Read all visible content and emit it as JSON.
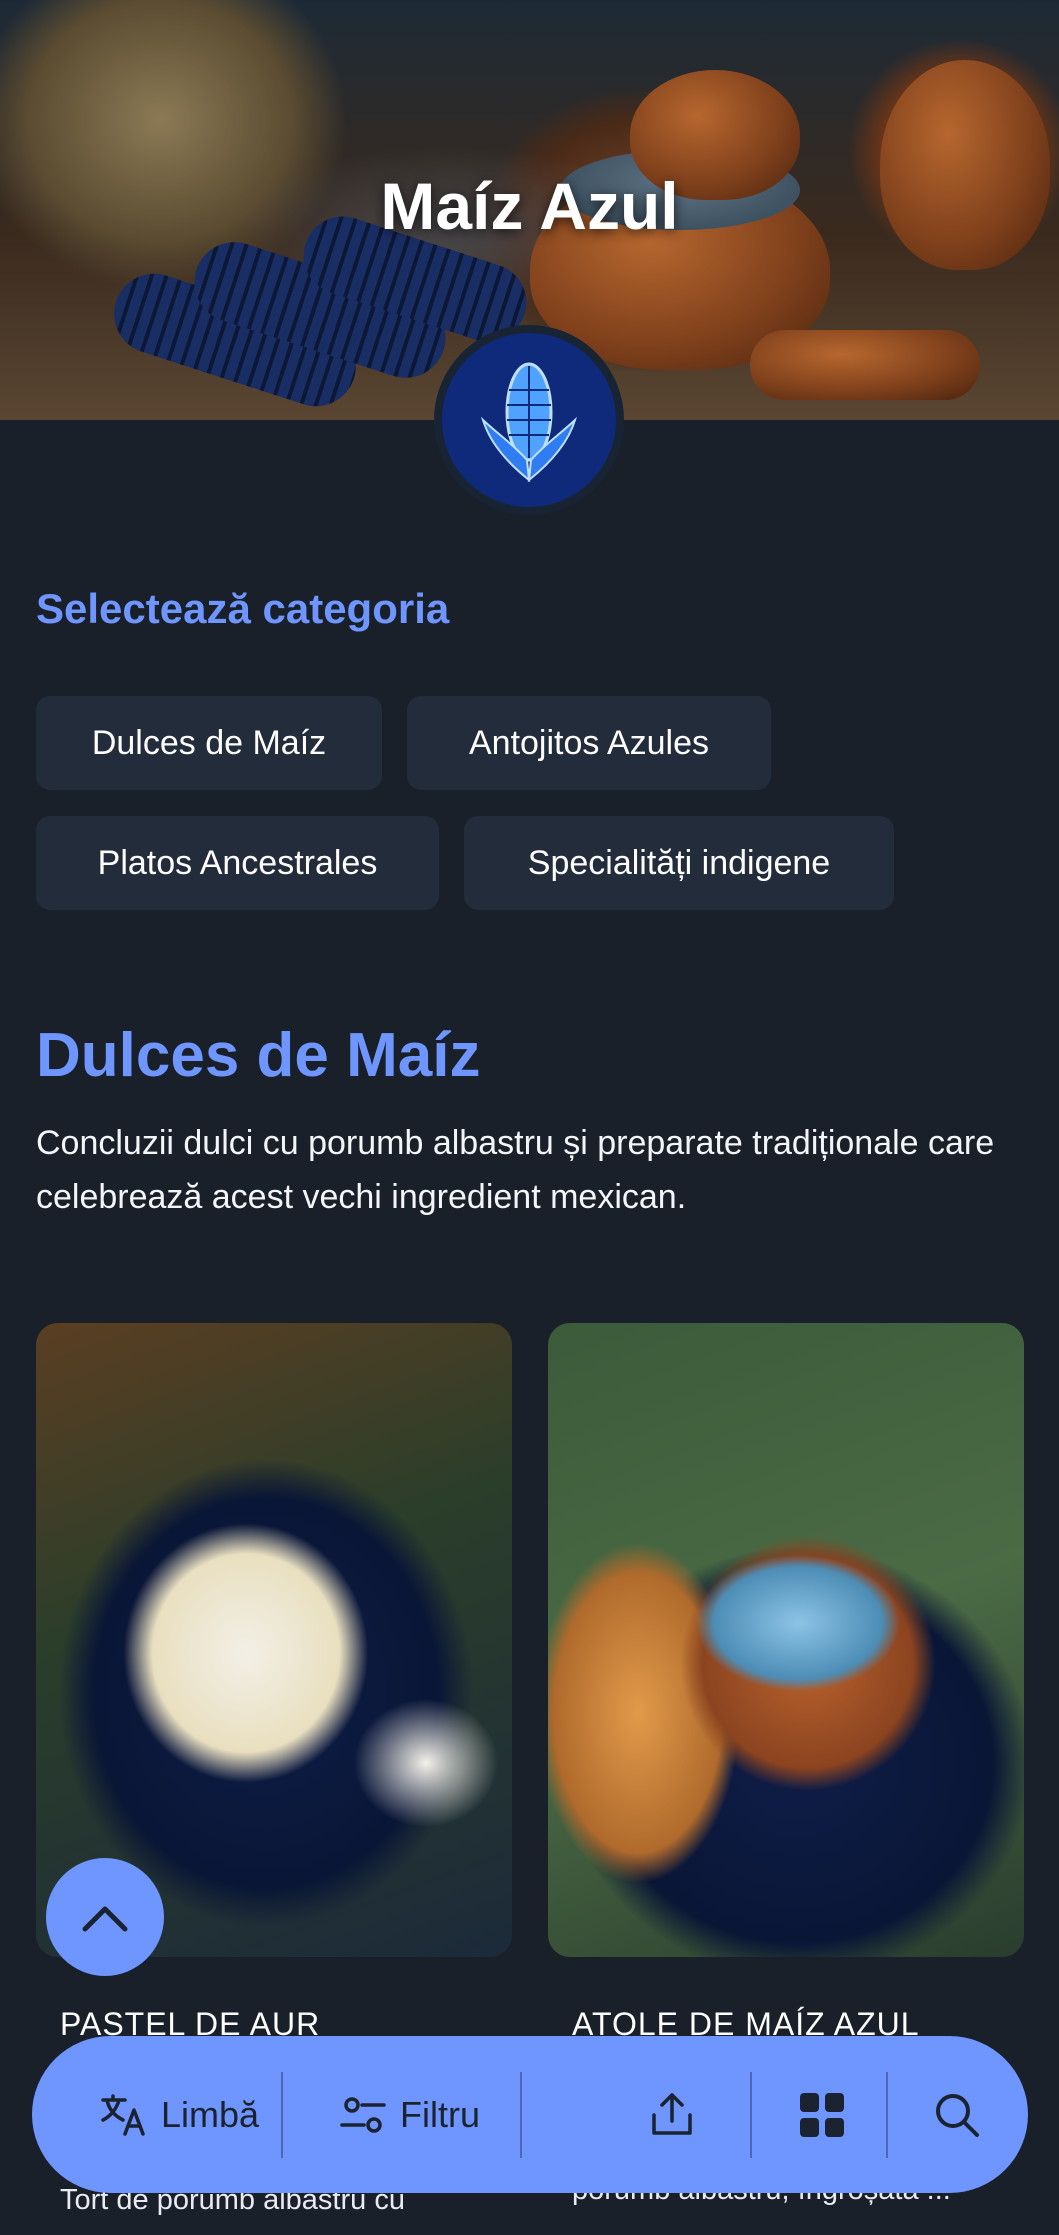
{
  "hero": {
    "title": "Maíz Azul"
  },
  "categories": {
    "heading": "Selectează categoria",
    "chips": [
      "Dulces de Maíz",
      "Antojitos Azules",
      "Platos Ancestrales",
      "Specialități indigene"
    ]
  },
  "section": {
    "title": "Dulces de Maíz",
    "description": "Concluzii dulci cu porumb albastru și preparate tradiționale care celebrează acest vechi ingredient mexican."
  },
  "cards": [
    {
      "title": "PASTEL DE AUR",
      "text": "Tort de porumb albastru cu"
    },
    {
      "title": "ATOLE DE MAÍZ AZUL",
      "text": "porumb albastru, îngroșată ..."
    }
  ],
  "bottom_bar": {
    "language_label": "Limbă",
    "filter_label": "Filtru"
  },
  "colors": {
    "accent": "#6f96ff",
    "background": "#19202a",
    "chip_bg": "#222c3b"
  }
}
